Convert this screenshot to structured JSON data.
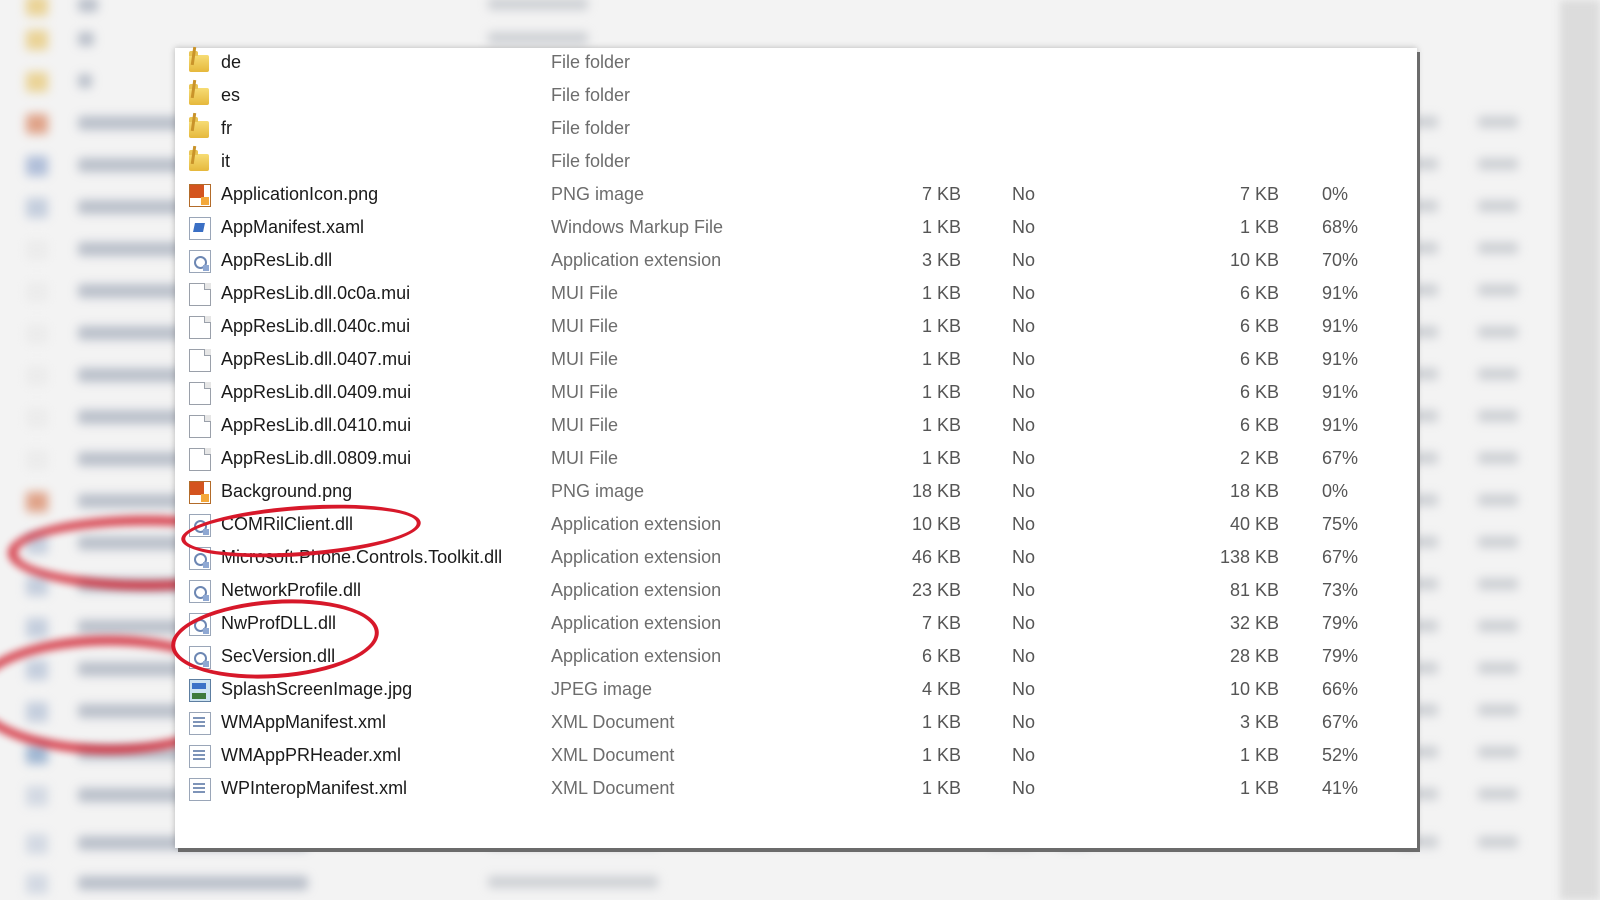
{
  "files": [
    {
      "name": "de",
      "type": "File folder",
      "size": "",
      "password": "",
      "compressed": "",
      "ratio": "",
      "icon": "folder-icon"
    },
    {
      "name": "es",
      "type": "File folder",
      "size": "",
      "password": "",
      "compressed": "",
      "ratio": "",
      "icon": "folder-icon"
    },
    {
      "name": "fr",
      "type": "File folder",
      "size": "",
      "password": "",
      "compressed": "",
      "ratio": "",
      "icon": "folder-icon"
    },
    {
      "name": "it",
      "type": "File folder",
      "size": "",
      "password": "",
      "compressed": "",
      "ratio": "",
      "icon": "folder-icon"
    },
    {
      "name": "ApplicationIcon.png",
      "type": "PNG image",
      "size": "7 KB",
      "password": "No",
      "compressed": "7 KB",
      "ratio": "0%",
      "icon": "png-file-icon"
    },
    {
      "name": "AppManifest.xaml",
      "type": "Windows Markup File",
      "size": "1 KB",
      "password": "No",
      "compressed": "1 KB",
      "ratio": "68%",
      "icon": "xaml-file-icon"
    },
    {
      "name": "AppResLib.dll",
      "type": "Application extension",
      "size": "3 KB",
      "password": "No",
      "compressed": "10 KB",
      "ratio": "70%",
      "icon": "dll-file-icon"
    },
    {
      "name": "AppResLib.dll.0c0a.mui",
      "type": "MUI File",
      "size": "1 KB",
      "password": "No",
      "compressed": "6 KB",
      "ratio": "91%",
      "icon": "mui-file-icon"
    },
    {
      "name": "AppResLib.dll.040c.mui",
      "type": "MUI File",
      "size": "1 KB",
      "password": "No",
      "compressed": "6 KB",
      "ratio": "91%",
      "icon": "mui-file-icon"
    },
    {
      "name": "AppResLib.dll.0407.mui",
      "type": "MUI File",
      "size": "1 KB",
      "password": "No",
      "compressed": "6 KB",
      "ratio": "91%",
      "icon": "mui-file-icon"
    },
    {
      "name": "AppResLib.dll.0409.mui",
      "type": "MUI File",
      "size": "1 KB",
      "password": "No",
      "compressed": "6 KB",
      "ratio": "91%",
      "icon": "mui-file-icon"
    },
    {
      "name": "AppResLib.dll.0410.mui",
      "type": "MUI File",
      "size": "1 KB",
      "password": "No",
      "compressed": "6 KB",
      "ratio": "91%",
      "icon": "mui-file-icon"
    },
    {
      "name": "AppResLib.dll.0809.mui",
      "type": "MUI File",
      "size": "1 KB",
      "password": "No",
      "compressed": "2 KB",
      "ratio": "67%",
      "icon": "mui-file-icon"
    },
    {
      "name": "Background.png",
      "type": "PNG image",
      "size": "18 KB",
      "password": "No",
      "compressed": "18 KB",
      "ratio": "0%",
      "icon": "png-file-icon"
    },
    {
      "name": "COMRilClient.dll",
      "type": "Application extension",
      "size": "10 KB",
      "password": "No",
      "compressed": "40 KB",
      "ratio": "75%",
      "icon": "dll-file-icon"
    },
    {
      "name": "Microsoft.Phone.Controls.Toolkit.dll",
      "type": "Application extension",
      "size": "46 KB",
      "password": "No",
      "compressed": "138 KB",
      "ratio": "67%",
      "icon": "dll-file-icon"
    },
    {
      "name": "NetworkProfile.dll",
      "type": "Application extension",
      "size": "23 KB",
      "password": "No",
      "compressed": "81 KB",
      "ratio": "73%",
      "icon": "dll-file-icon"
    },
    {
      "name": "NwProfDLL.dll",
      "type": "Application extension",
      "size": "7 KB",
      "password": "No",
      "compressed": "32 KB",
      "ratio": "79%",
      "icon": "dll-file-icon"
    },
    {
      "name": "SecVersion.dll",
      "type": "Application extension",
      "size": "6 KB",
      "password": "No",
      "compressed": "28 KB",
      "ratio": "79%",
      "icon": "dll-file-icon"
    },
    {
      "name": "SplashScreenImage.jpg",
      "type": "JPEG image",
      "size": "4 KB",
      "password": "No",
      "compressed": "10 KB",
      "ratio": "66%",
      "icon": "jpg-file-icon"
    },
    {
      "name": "WMAppManifest.xml",
      "type": "XML Document",
      "size": "1 KB",
      "password": "No",
      "compressed": "3 KB",
      "ratio": "67%",
      "icon": "xml-file-icon"
    },
    {
      "name": "WMAppPRHeader.xml",
      "type": "XML Document",
      "size": "1 KB",
      "password": "No",
      "compressed": "1 KB",
      "ratio": "52%",
      "icon": "xml-file-icon"
    },
    {
      "name": "WPInteropManifest.xml",
      "type": "XML Document",
      "size": "1 KB",
      "password": "No",
      "compressed": "1 KB",
      "ratio": "41%",
      "icon": "xml-file-icon"
    }
  ],
  "highlight_color": "#d7182a",
  "highlighted": [
    "COMRilClient.dll",
    "NwProfDLL.dll",
    "SecVersion.dll"
  ]
}
